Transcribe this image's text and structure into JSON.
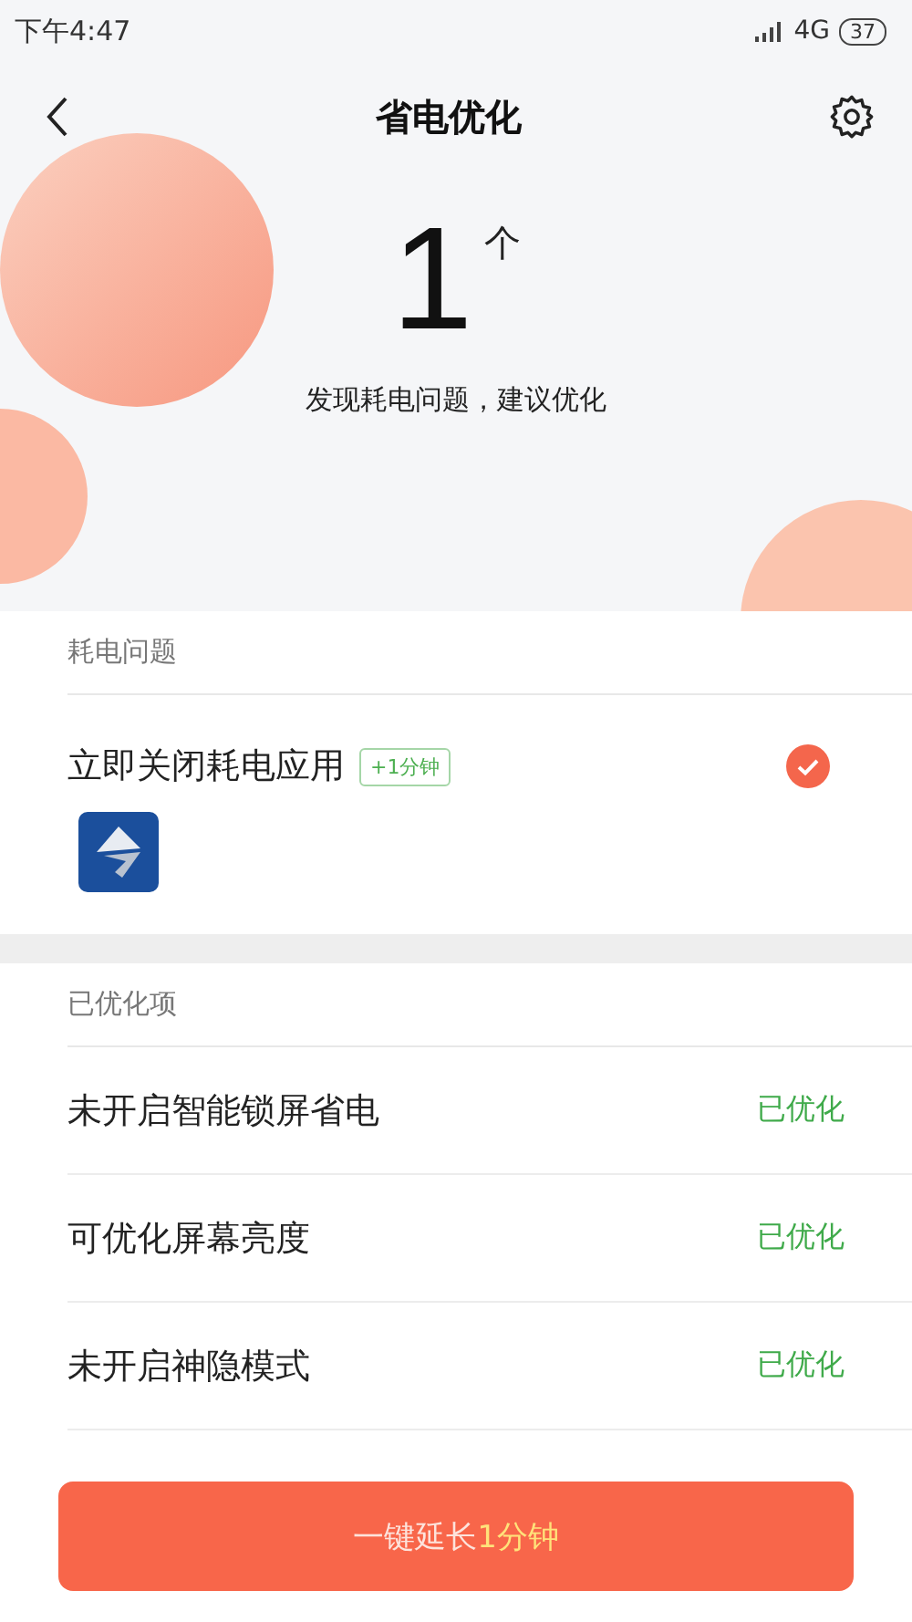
{
  "status_bar": {
    "time": "下午4:47",
    "network": "4G",
    "battery": "37"
  },
  "header": {
    "title": "省电优化"
  },
  "summary": {
    "count": "1",
    "unit": "个",
    "message": "发现耗电问题，建议优化"
  },
  "issues": {
    "heading": "耗电问题",
    "items": [
      {
        "title": "立即关闭耗电应用",
        "tag": "+1分钟",
        "checked": true
      }
    ]
  },
  "optimized": {
    "heading": "已优化项",
    "items": [
      {
        "title": "未开启智能锁屏省电",
        "status": "已优化"
      },
      {
        "title": "可优化屏幕亮度",
        "status": "已优化"
      },
      {
        "title": "未开启神隐模式",
        "status": "已优化"
      }
    ]
  },
  "action": {
    "text": "一键延长",
    "highlight": "1分钟"
  }
}
